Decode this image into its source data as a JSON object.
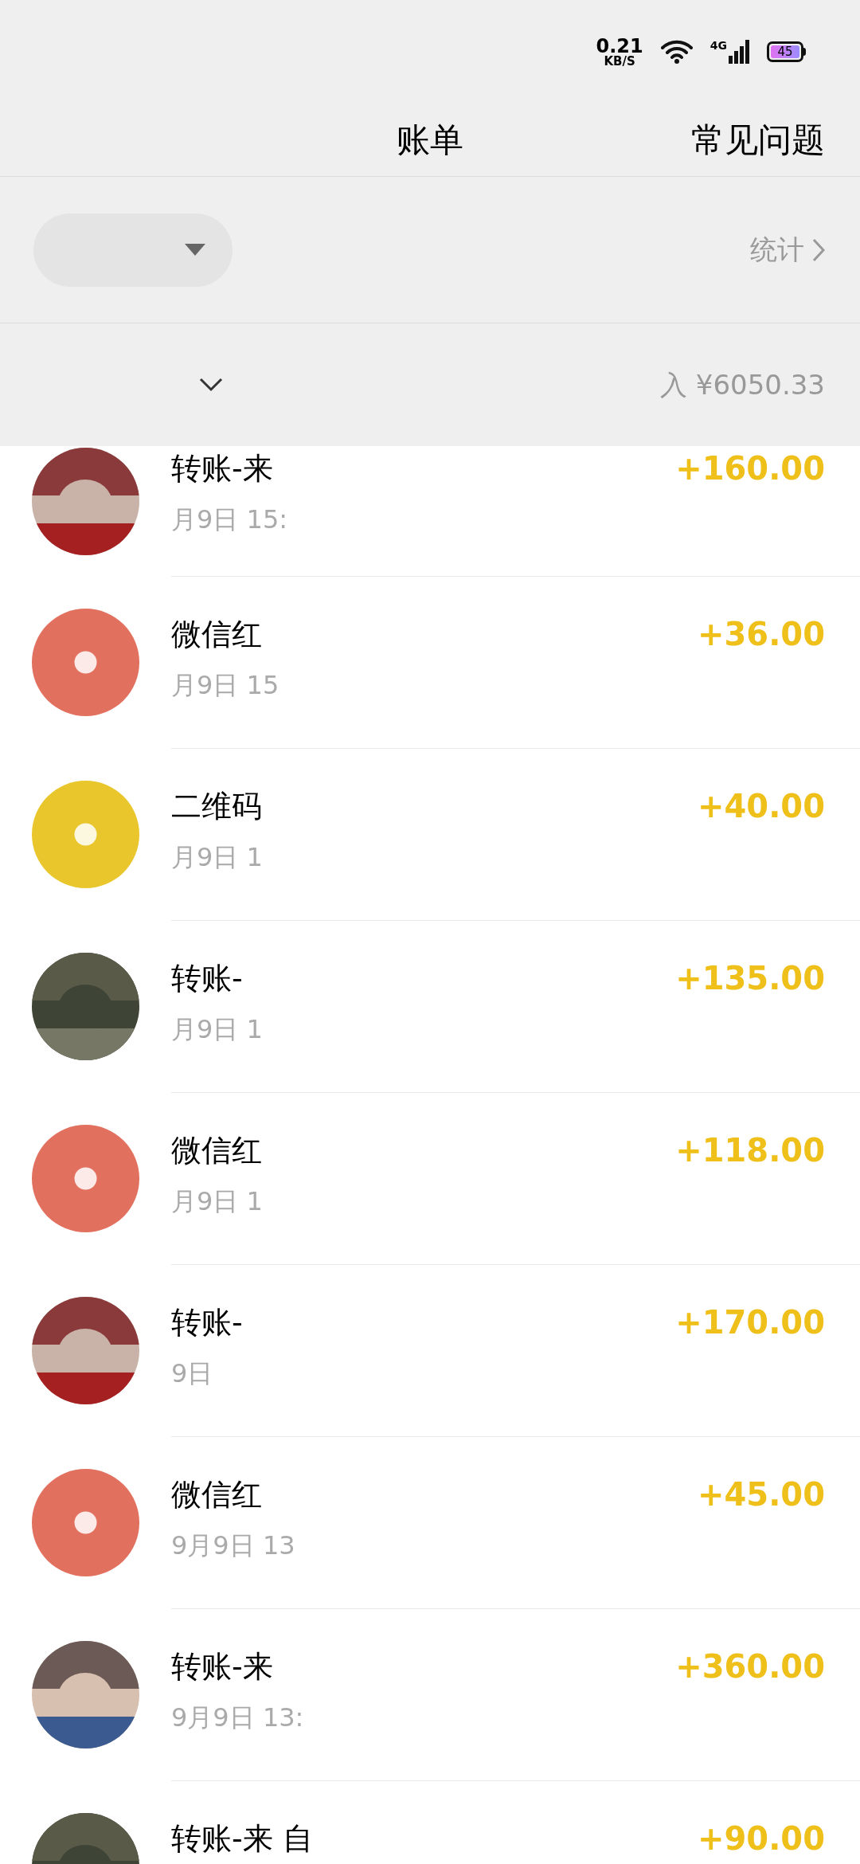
{
  "status_bar": {
    "speed": "0.21",
    "speed_unit": "KB/S",
    "network": "4G",
    "battery": "45"
  },
  "nav": {
    "title": "账单",
    "action": "常见问题"
  },
  "filter": {
    "stats_link": "统计"
  },
  "summary": {
    "text": "入 ¥6050.33"
  },
  "transactions": [
    {
      "title": "转账-来",
      "time": "月9日 15:",
      "amount": "+160.00"
    },
    {
      "kind": "red_packet",
      "title": "微信红",
      "time": "月9日 15",
      "amount": "+36.00"
    },
    {
      "kind": "qr_code",
      "title": "二维码",
      "time": "月9日 1",
      "amount": "+40.00"
    },
    {
      "title": "转账-",
      "time": "月9日 1",
      "amount": "+135.00"
    },
    {
      "kind": "red_packet",
      "title": "微信红",
      "time": "月9日 1",
      "amount": "+118.00"
    },
    {
      "title": "转账-",
      "time": "9日",
      "amount": "+170.00"
    },
    {
      "kind": "red_packet",
      "title": "微信红",
      "time": "9月9日 13",
      "amount": "+45.00"
    },
    {
      "title": "转账-来",
      "time": "9月9日 13:",
      "amount": "+360.00"
    },
    {
      "title": "转账-来 自",
      "amount": "+90.00"
    }
  ]
}
